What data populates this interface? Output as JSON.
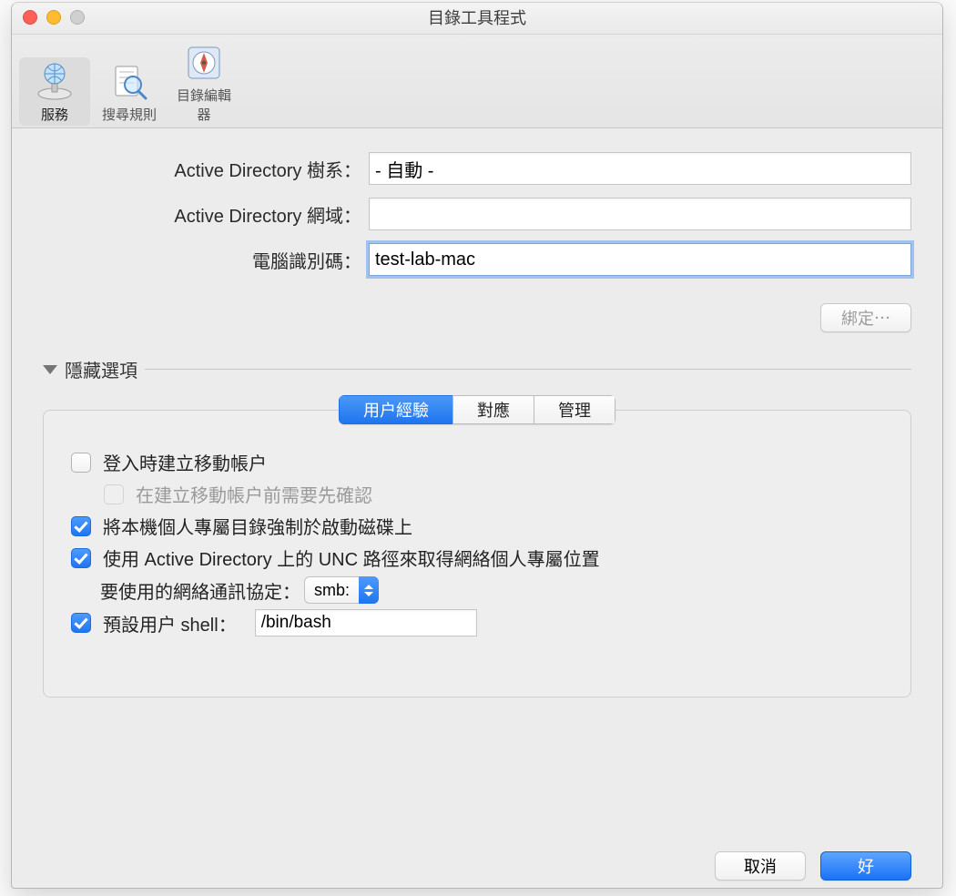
{
  "window": {
    "title": "目錄工具程式"
  },
  "toolbar": {
    "items": [
      {
        "label": "服務"
      },
      {
        "label": "搜尋規則"
      },
      {
        "label": "目錄編輯器"
      }
    ]
  },
  "form": {
    "forest_label": "Active Directory 樹系：",
    "forest_value": "- 自動 -",
    "domain_label": "Active Directory 網域：",
    "domain_value": "",
    "computerid_label": "電腦識別碼：",
    "computerid_value": "test-lab-mac"
  },
  "bind_button": "綁定⋯",
  "disclosure_label": "隱藏選項",
  "seg_tabs": {
    "user_experience": "用户經驗",
    "mappings": "對應",
    "administrative": "管理"
  },
  "options": {
    "create_mobile_label": "登入時建立移動帳户",
    "create_mobile_checked": false,
    "confirm_mobile_label": "在建立移動帳户前需要先確認",
    "confirm_mobile_checked": false,
    "force_local_label": "將本機個人專屬目錄強制於啟動磁碟上",
    "force_local_checked": true,
    "use_unc_label": "使用 Active Directory 上的 UNC 路徑來取得網絡個人專屬位置",
    "use_unc_checked": true,
    "protocol_label": "要使用的網絡通訊協定：",
    "protocol_value": "smb:",
    "shell_label": "預設用户 shell：",
    "shell_checked": true,
    "shell_value": "/bin/bash"
  },
  "footer": {
    "cancel": "取消",
    "ok": "好"
  }
}
